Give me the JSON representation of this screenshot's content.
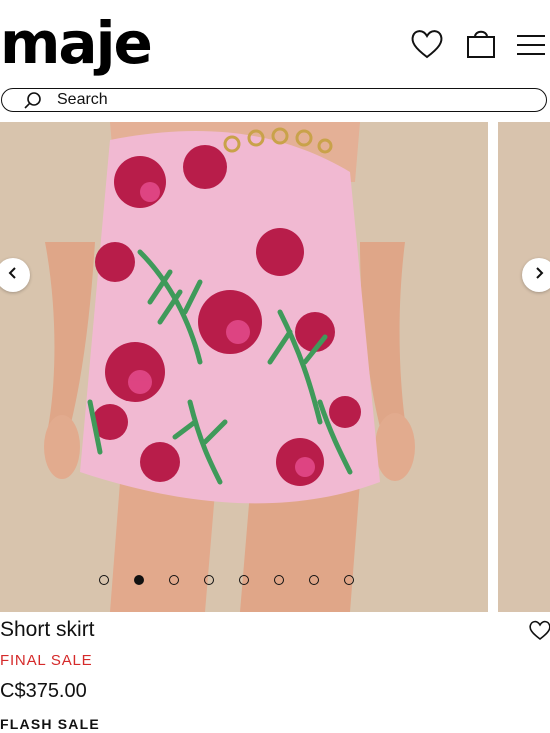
{
  "header": {
    "logo": "maje",
    "icons": [
      "heart-icon",
      "shopping-bag-icon",
      "menu-icon"
    ]
  },
  "search": {
    "placeholder": "Search",
    "icon": "search-icon"
  },
  "gallery": {
    "total_images": 8,
    "active_index": 1,
    "prev_icon": "chevron-left-icon",
    "next_icon": "chevron-right-icon"
  },
  "product": {
    "name": "Short skirt",
    "sale_label": "FINAL SALE",
    "price": "C$375.00",
    "promo": "FLASH SALE",
    "wishlist_icon": "heart-icon"
  },
  "colors": {
    "sale_red": "#d52a2a",
    "text": "#111111",
    "background": "#ffffff"
  }
}
